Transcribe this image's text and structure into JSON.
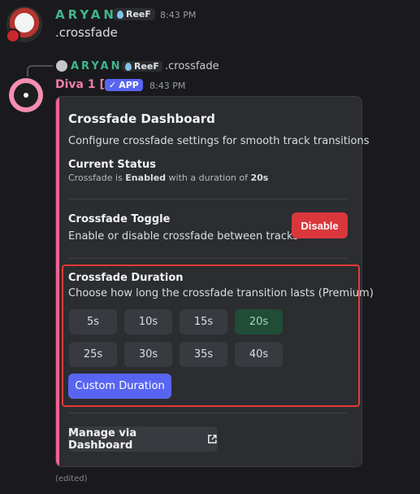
{
  "message1": {
    "username": "ARYAN",
    "tag": "ReeF",
    "time": "8:43 PM",
    "text": ".crossfade"
  },
  "reply": {
    "username": "ARYAN",
    "tag": "ReeF",
    "text": ".crossfade"
  },
  "bot": {
    "name": "Diva 1 [.]",
    "badge": "APP",
    "time": "8:43 PM"
  },
  "card": {
    "title": "Crossfade Dashboard",
    "description": "Configure crossfade settings for smooth track transitions",
    "status_title": "Current Status",
    "status_prefix": "Crossfade is ",
    "status_state": "Enabled",
    "status_mid": " with a duration of ",
    "status_duration": "20s",
    "toggle_title": "Crossfade Toggle",
    "toggle_desc": "Enable or disable crossfade between tracks",
    "disable_label": "Disable",
    "duration_title": "Crossfade Duration",
    "duration_desc": "Choose how long the crossfade transition lasts (Premium)",
    "options": [
      "5s",
      "10s",
      "15s",
      "20s",
      "25s",
      "30s",
      "35s",
      "40s"
    ],
    "selected_option": "20s",
    "custom_label": "Custom Duration",
    "manage_label": "Manage via Dashboard"
  },
  "edited": "(edited)",
  "colors": {
    "accent": "#f06292",
    "danger": "#da373c",
    "blurple": "#5865f2",
    "selected": "#1f4d36",
    "highlight": "#e53935"
  }
}
